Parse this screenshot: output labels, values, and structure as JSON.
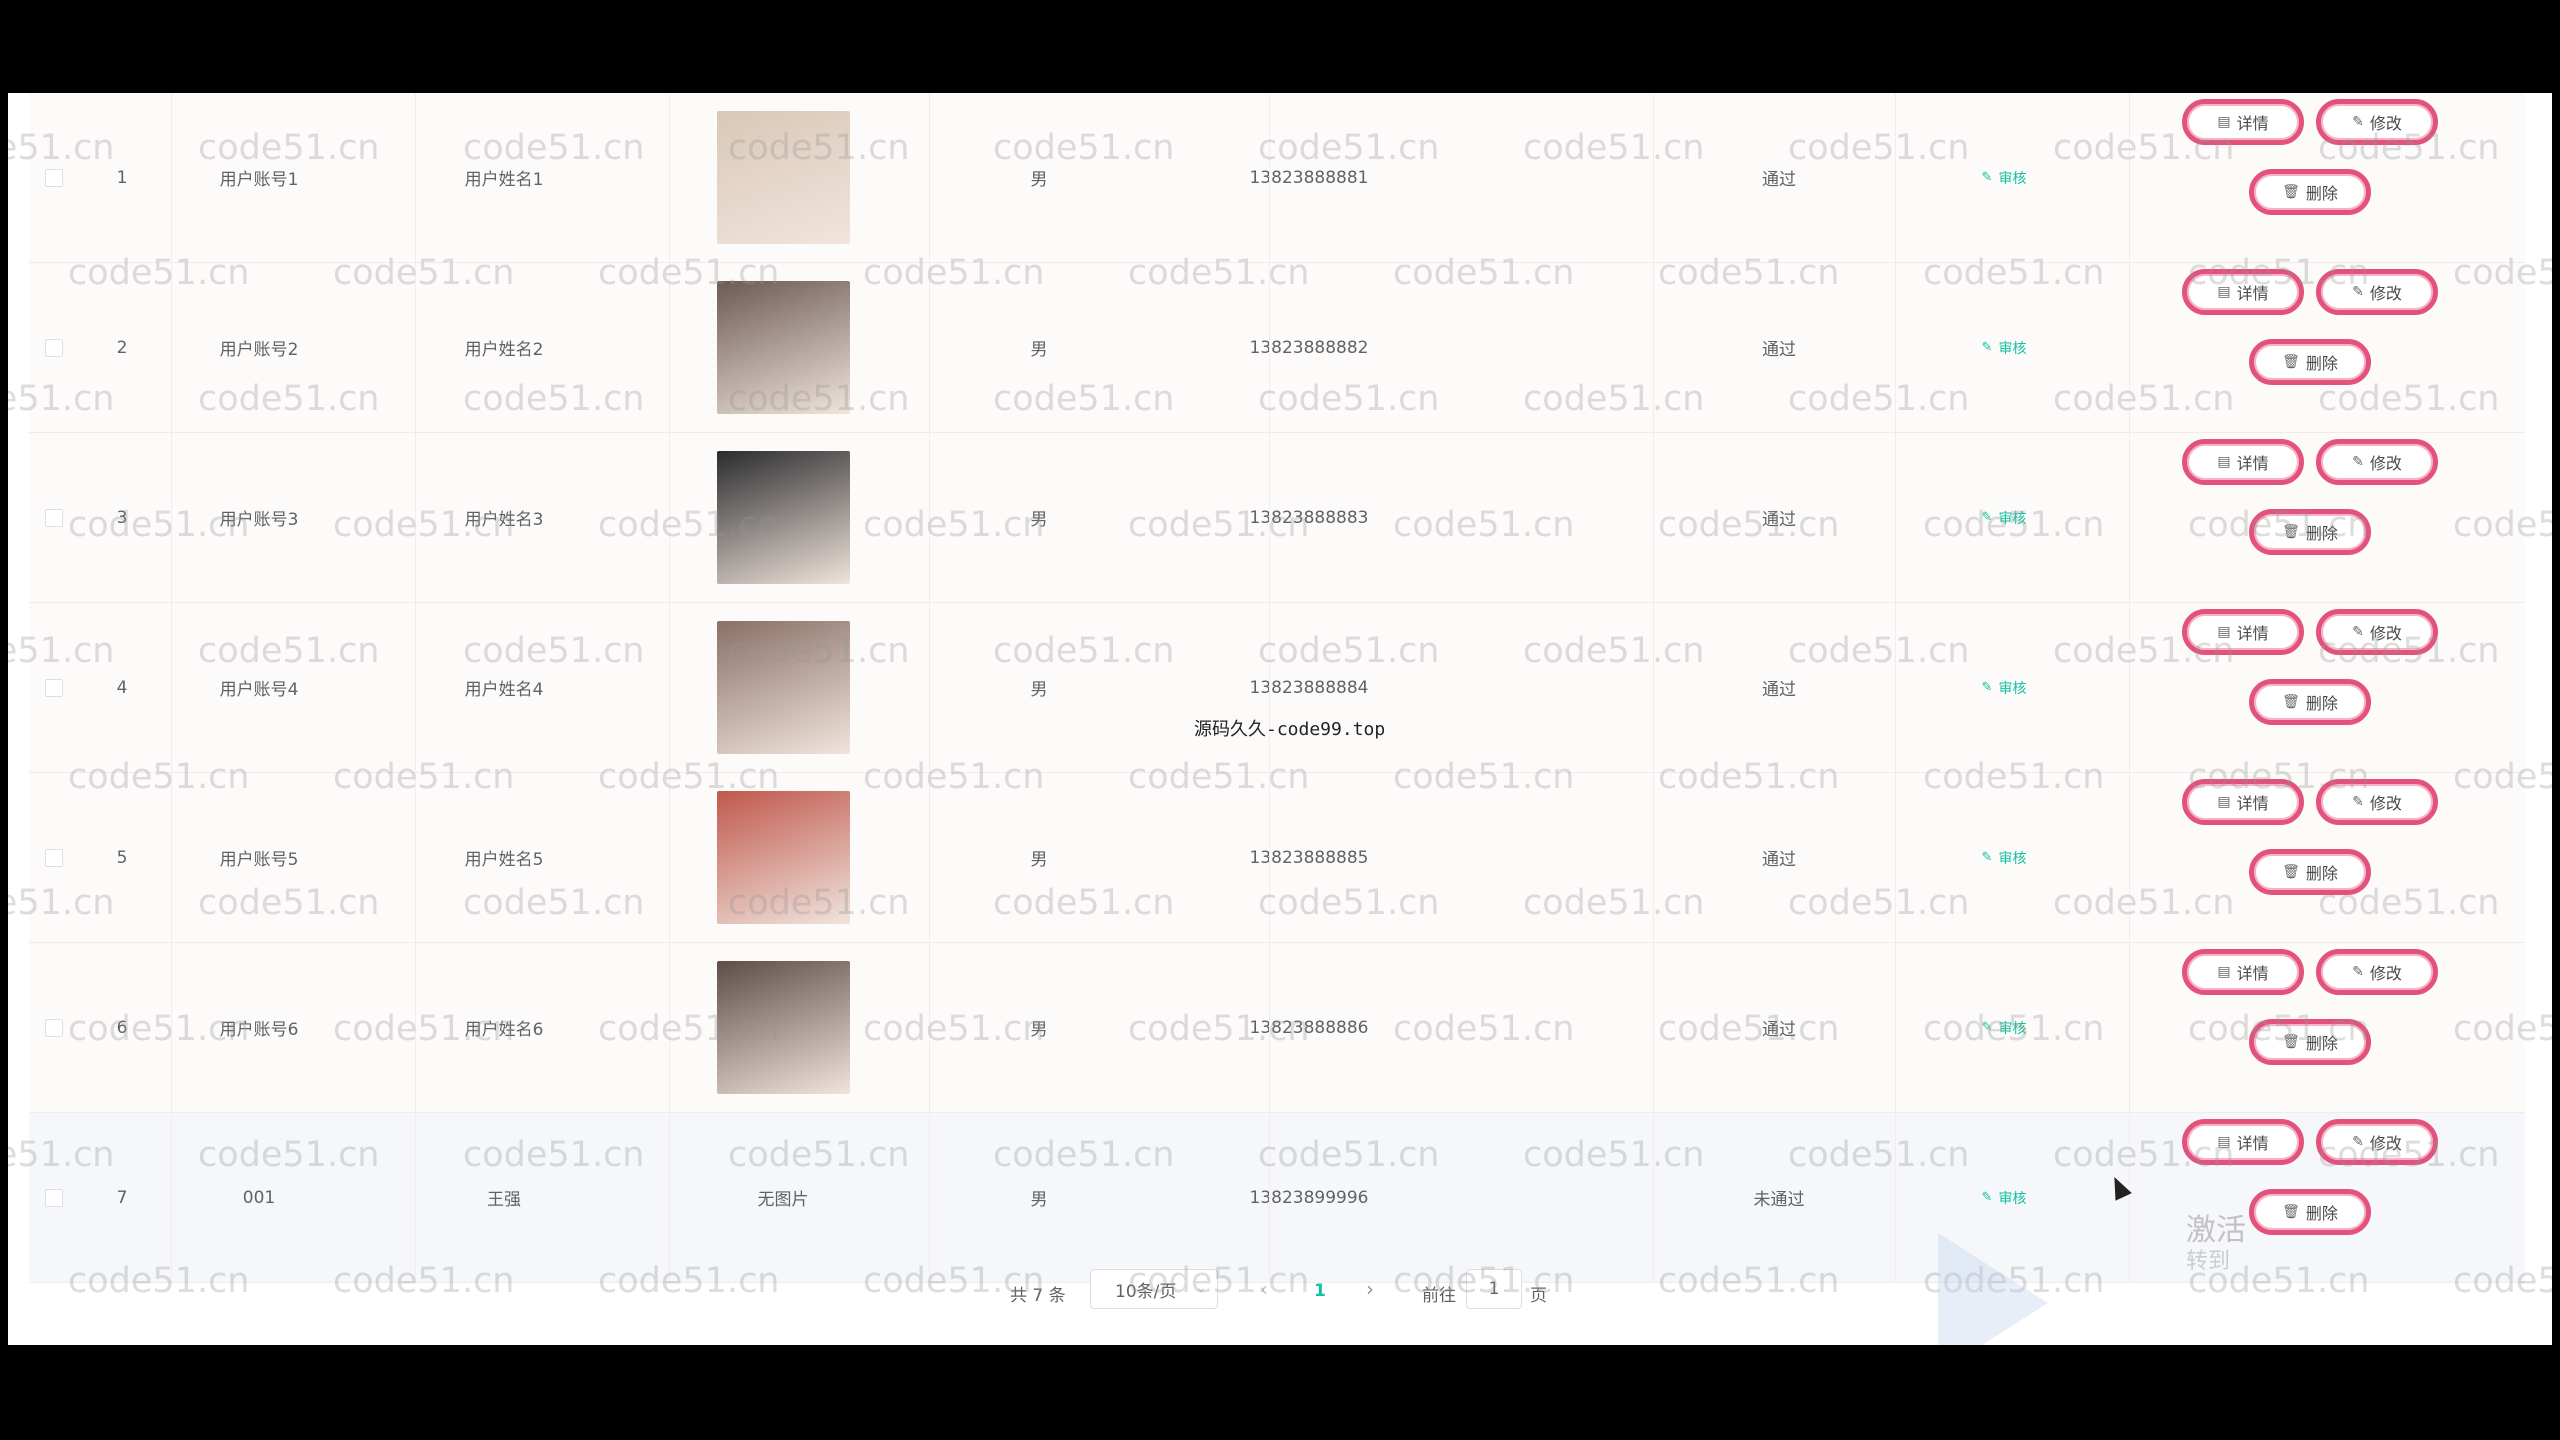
{
  "table": {
    "rows": [
      {
        "index": "1",
        "account": "用户账号1",
        "name": "用户姓名1",
        "photo": "photo",
        "photo_color": "#d9c8b6",
        "sex": "男",
        "phone": "13823888881",
        "status": "通过",
        "audit": "审核"
      },
      {
        "index": "2",
        "account": "用户账号2",
        "name": "用户姓名2",
        "photo": "photo",
        "photo_color": "#6c5a54",
        "sex": "男",
        "phone": "13823888882",
        "status": "通过",
        "audit": "审核"
      },
      {
        "index": "3",
        "account": "用户账号3",
        "name": "用户姓名3",
        "photo": "photo",
        "photo_color": "#2b2b2e",
        "sex": "男",
        "phone": "13823888883",
        "status": "通过",
        "audit": "审核"
      },
      {
        "index": "4",
        "account": "用户账号4",
        "name": "用户姓名4",
        "photo": "photo",
        "photo_color": "#8a7066",
        "sex": "男",
        "phone": "13823888884",
        "status": "通过",
        "audit": "审核"
      },
      {
        "index": "5",
        "account": "用户账号5",
        "name": "用户姓名5",
        "photo": "photo",
        "photo_color": "#c0584d",
        "sex": "男",
        "phone": "13823888885",
        "status": "通过",
        "audit": "审核"
      },
      {
        "index": "6",
        "account": "用户账号6",
        "name": "用户姓名6",
        "photo": "photo",
        "photo_color": "#5e4d48",
        "sex": "男",
        "phone": "13823888886",
        "status": "通过",
        "audit": "审核"
      },
      {
        "index": "7",
        "account": "001",
        "name": "王强",
        "photo": "none",
        "no_photo_text": "无图片",
        "sex": "男",
        "phone": "13823899996",
        "status": "未通过",
        "audit": "审核"
      }
    ],
    "actions": {
      "detail": "详情",
      "edit": "修改",
      "delete": "删除"
    },
    "icons": {
      "detail": "document-icon",
      "edit": "edit-icon",
      "delete": "trash-icon",
      "audit": "edit-icon"
    }
  },
  "pagination": {
    "total": "共 7 条",
    "page_size": "10条/页",
    "current": "1",
    "goto_label": "前往",
    "goto_value": "1",
    "page_label": "页"
  },
  "overlays": {
    "center_note": "源码久久-code99.top",
    "watermark": "code51.cn",
    "brand_line1": "激活",
    "brand_line2": "转到"
  },
  "colors": {
    "accent": "#13c2a2",
    "button_border": "#e2527c",
    "text": "#606266"
  }
}
